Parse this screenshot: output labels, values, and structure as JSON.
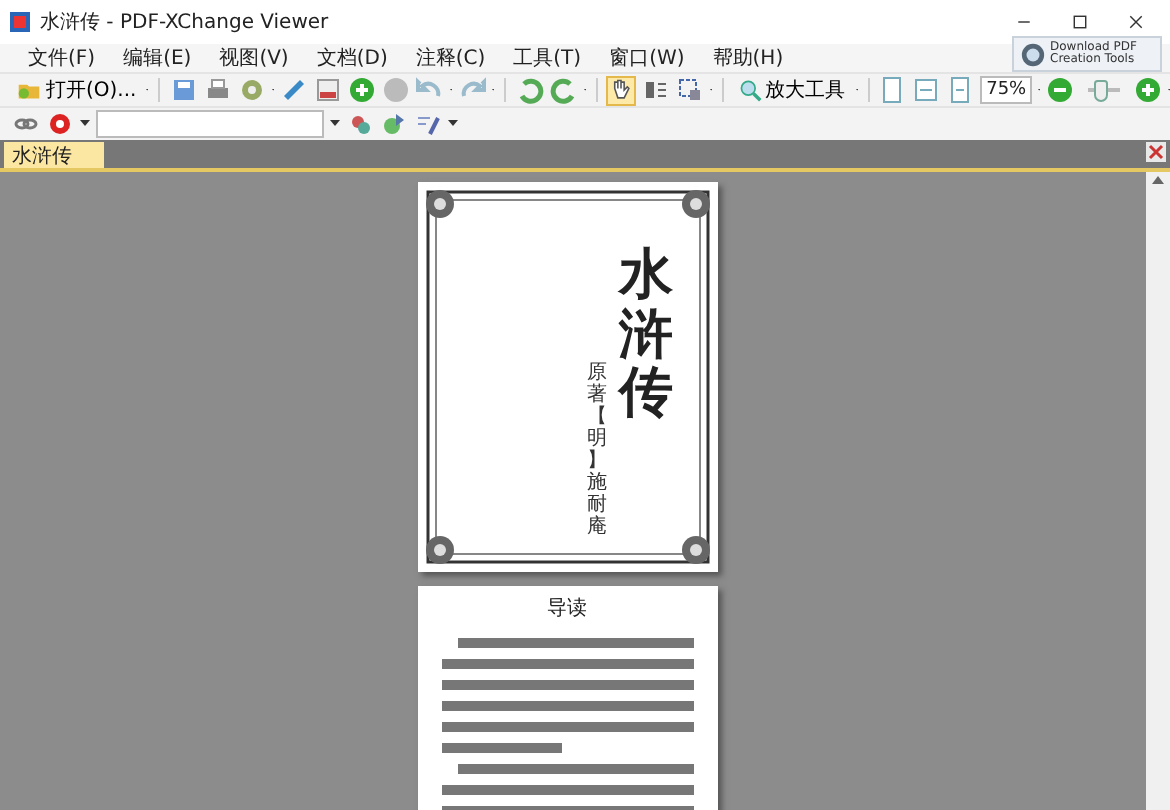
{
  "window": {
    "title": "水浒传 - PDF-XChange Viewer"
  },
  "menu": [
    "文件(F)",
    "编辑(E)",
    "视图(V)",
    "文档(D)",
    "注释(C)",
    "工具(T)",
    "窗口(W)",
    "帮助(H)"
  ],
  "promo": {
    "label": "Download PDF Creation Tools"
  },
  "toolbar": {
    "open_label": "打开(O)...",
    "hand_tool": {
      "selected": true
    },
    "zoom_tool_label": "放大工具",
    "zoom_value": "75%",
    "zoom_slider": {
      "level": 0.35
    }
  },
  "tabs": [
    {
      "label": "水浒传",
      "selected": true
    }
  ],
  "document": {
    "cover": {
      "title": "水浒传",
      "author": "原著【明】施耐庵"
    },
    "page_2": {
      "heading": "导读"
    }
  }
}
